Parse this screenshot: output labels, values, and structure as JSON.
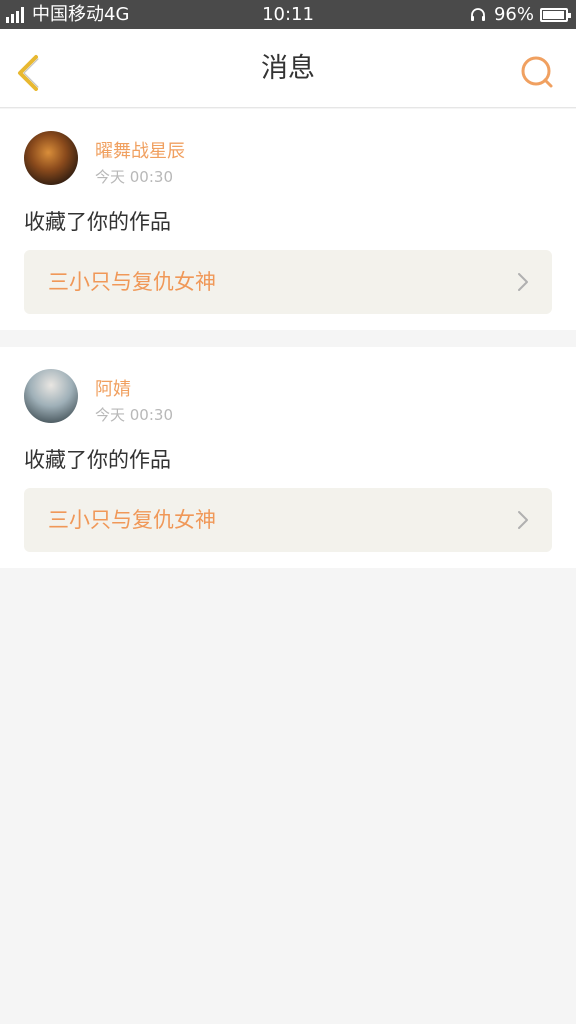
{
  "status_bar": {
    "carrier": "中国移动4G",
    "time": "10:11",
    "battery": "96%",
    "battery_level": 0.96
  },
  "header": {
    "title": "消息"
  },
  "messages": [
    {
      "username": "曜舞战星辰",
      "time": "今天 00:30",
      "action": "收藏了你的作品",
      "work_title": "三小只与复仇女神"
    },
    {
      "username": "阿婧",
      "time": "今天 00:30",
      "action": "收藏了你的作品",
      "work_title": "三小只与复仇女神"
    }
  ],
  "colors": {
    "accent": "#f0a060",
    "back_icon": "#e8b830",
    "card_link_bg": "#f3f2ec",
    "status_bar_bg": "#4a4a4a"
  },
  "icons": {
    "back": "chevron-left-icon",
    "search": "search-icon",
    "link": "chevron-right-icon"
  }
}
